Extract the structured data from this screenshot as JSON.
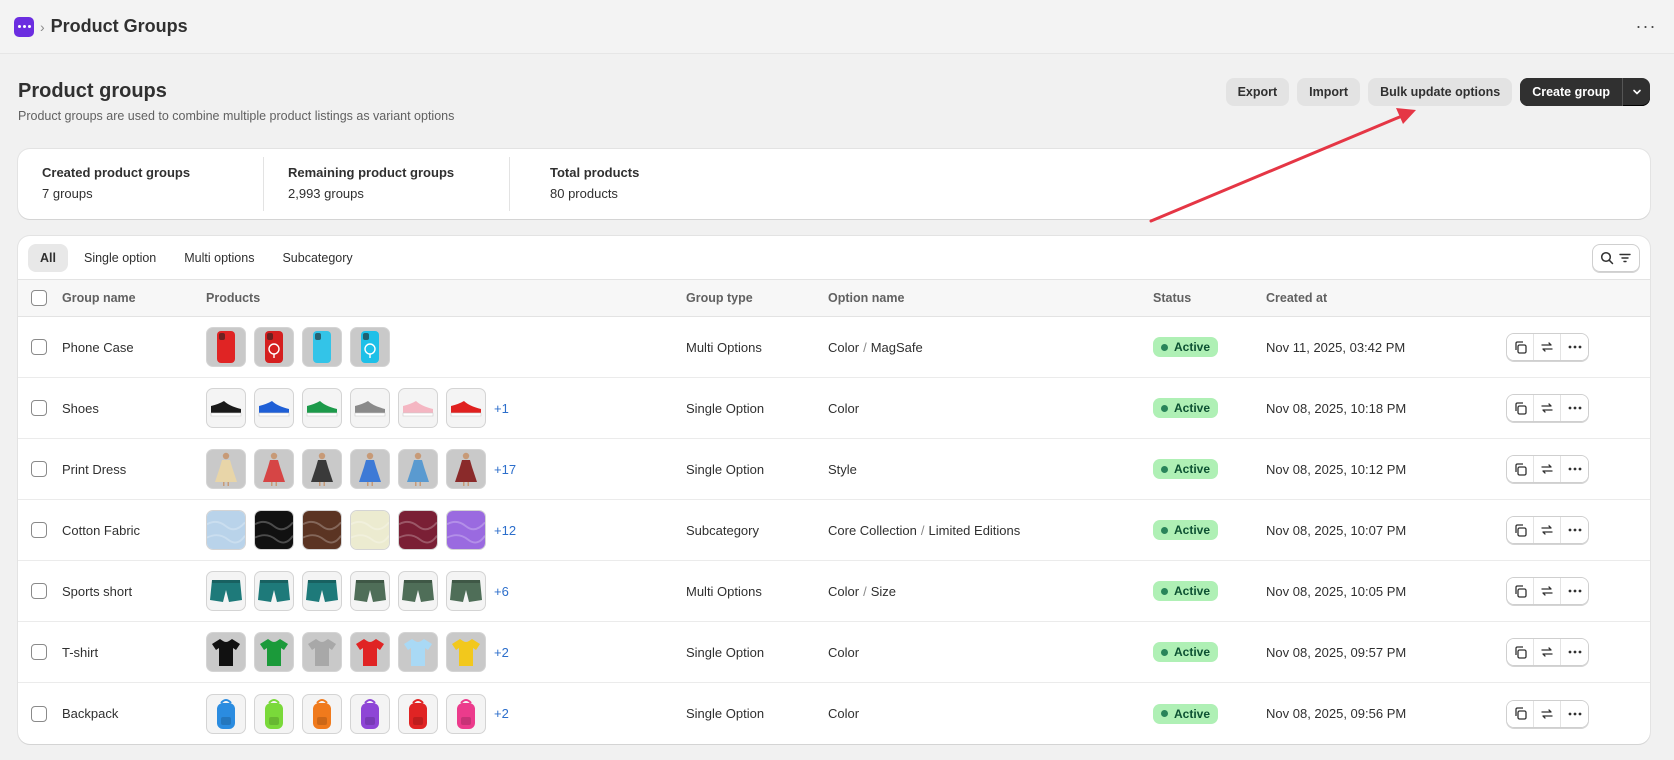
{
  "topbar": {
    "breadcrumb_title": "Product Groups",
    "app_icon": "app-grid-icon",
    "more_label": "···"
  },
  "header": {
    "title": "Product groups",
    "subtitle": "Product groups are used to combine multiple product listings as variant options",
    "buttons": {
      "export": "Export",
      "import": "Import",
      "bulk_update": "Bulk update options",
      "create": "Create group"
    }
  },
  "stats": [
    {
      "label": "Created product groups",
      "value": "7 groups"
    },
    {
      "label": "Remaining product groups",
      "value": "2,993 groups"
    },
    {
      "label": "Total products",
      "value": "80 products"
    }
  ],
  "tabs": [
    "All",
    "Single option",
    "Multi options",
    "Subcategory"
  ],
  "columns": {
    "name": "Group name",
    "products": "Products",
    "type": "Group type",
    "option": "Option name",
    "status": "Status",
    "created": "Created at"
  },
  "rows": [
    {
      "name": "Phone Case",
      "type": "Multi Options",
      "options": [
        "Color",
        "MagSafe"
      ],
      "status": "Active",
      "created": "Nov 11, 2025, 03:42 PM",
      "more": "",
      "thumbs": [
        "#e02424|phone",
        "#d51f1f|phone-ring",
        "#33c4e8|phone",
        "#1ec0e8|phone-ring"
      ],
      "gray": true
    },
    {
      "name": "Shoes",
      "type": "Single Option",
      "options": [
        "Color"
      ],
      "status": "Active",
      "created": "Nov 08, 2025, 10:18 PM",
      "more": "+1",
      "thumbs": [
        "#1a1a1a|shoe",
        "#1f5fd6|shoe",
        "#1c9a4a|shoe",
        "#8a8a8a|shoe",
        "#f4b6c2|shoe",
        "#e0201f|shoe"
      ],
      "gray": false
    },
    {
      "name": "Print Dress",
      "type": "Single Option",
      "options": [
        "Style"
      ],
      "status": "Active",
      "created": "Nov 08, 2025, 10:12 PM",
      "more": "+17",
      "thumbs": [
        "#e8d5a8|dress",
        "#d64545|dress",
        "#3a3a3a|dress",
        "#3d7ad6|dress",
        "#5a9ad0|dress",
        "#8a2a2a|dress"
      ],
      "gray": true
    },
    {
      "name": "Cotton Fabric",
      "type": "Subcategory",
      "options": [
        "Core Collection",
        "Limited Editions"
      ],
      "status": "Active",
      "created": "Nov 08, 2025, 10:07 PM",
      "more": "+12",
      "thumbs": [
        "#b9d3ea|fabric",
        "#111111|fabric",
        "#5b3423|fabric",
        "#ecebd0|fabric",
        "#7a1f35|fabric",
        "#9a6ae0|fabric"
      ],
      "gray": false
    },
    {
      "name": "Sports short",
      "type": "Multi Options",
      "options": [
        "Color",
        "Size"
      ],
      "status": "Active",
      "created": "Nov 08, 2025, 10:05 PM",
      "more": "+6",
      "thumbs": [
        "#1e7a7a|short",
        "#1e7a7a|short",
        "#1e7a7a|short",
        "#4f6e58|short",
        "#4f6e58|short",
        "#4f6e58|short"
      ],
      "gray": false
    },
    {
      "name": "T-shirt",
      "type": "Single Option",
      "options": [
        "Color"
      ],
      "status": "Active",
      "created": "Nov 08, 2025, 09:57 PM",
      "more": "+2",
      "thumbs": [
        "#111111|tee",
        "#1b9a3a|tee",
        "#a8a8a8|tee",
        "#e02424|tee",
        "#a9d9f5|tee",
        "#f2c81c|tee"
      ],
      "gray": true
    },
    {
      "name": "Backpack",
      "type": "Single Option",
      "options": [
        "Color"
      ],
      "status": "Active",
      "created": "Nov 08, 2025, 09:56 PM",
      "more": "+2",
      "thumbs": [
        "#2b8ce0|bag",
        "#7ad93a|bag",
        "#f07a1c|bag",
        "#8e45d6|bag",
        "#e02424|bag",
        "#ec3b8c|bag"
      ],
      "gray": false
    }
  ],
  "row_actions": [
    "duplicate-icon",
    "sync-icon",
    "more-icon"
  ],
  "colors": {
    "accent": "#303030",
    "link": "#2c6ecb",
    "badge_bg": "#aff0b5",
    "badge_text": "#0c5132",
    "arrow": "#e53645"
  }
}
